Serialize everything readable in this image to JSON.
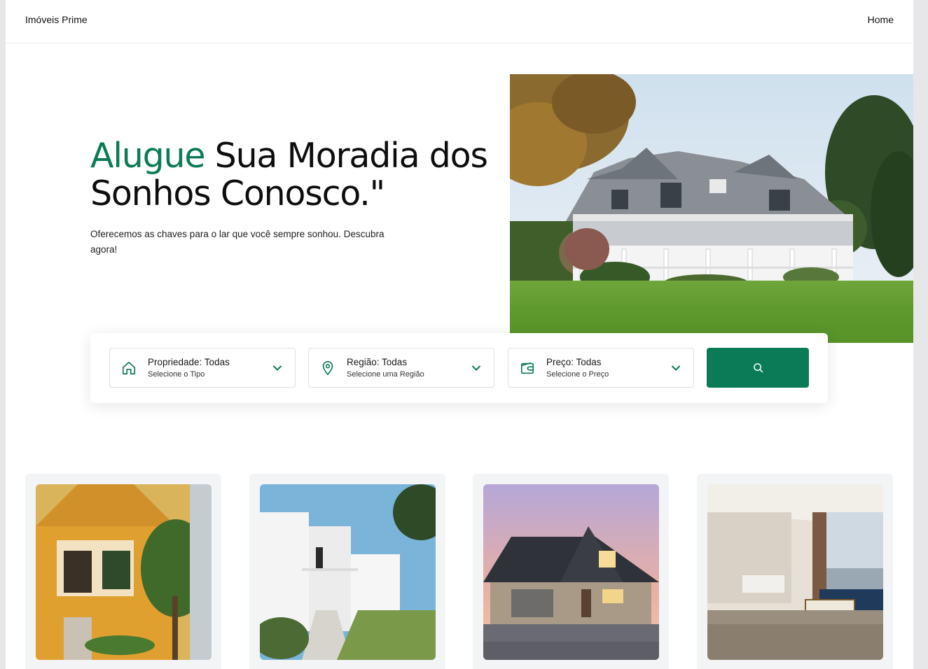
{
  "brand": {
    "name": "Imóveis Prime"
  },
  "nav": {
    "home_label": "Home"
  },
  "hero": {
    "title_accent": "Alugue",
    "title_rest": " Sua Moradia dos Sonhos Conosco.\"",
    "subtitle": "Oferecemos as chaves para o lar que você sempre sonhou. Descubra agora!",
    "image_icon": "white-house-photo"
  },
  "search": {
    "accent_color": "#0b7a56",
    "filters": [
      {
        "label": "Propriedade: Todas",
        "hint": "Selecione o Tipo",
        "icon": "home-icon"
      },
      {
        "label": "Região: Todas",
        "hint": "Selecione uma Região",
        "icon": "location-pin-icon"
      },
      {
        "label": "Preço: Todas",
        "hint": "Selecione o Preço",
        "icon": "wallet-icon"
      }
    ],
    "button_icon": "search-icon"
  },
  "listings": [
    {
      "photo": "yellow-house-photo"
    },
    {
      "photo": "white-modern-house-photo"
    },
    {
      "photo": "suburban-house-dusk-photo"
    },
    {
      "photo": "living-room-interior-photo"
    }
  ]
}
